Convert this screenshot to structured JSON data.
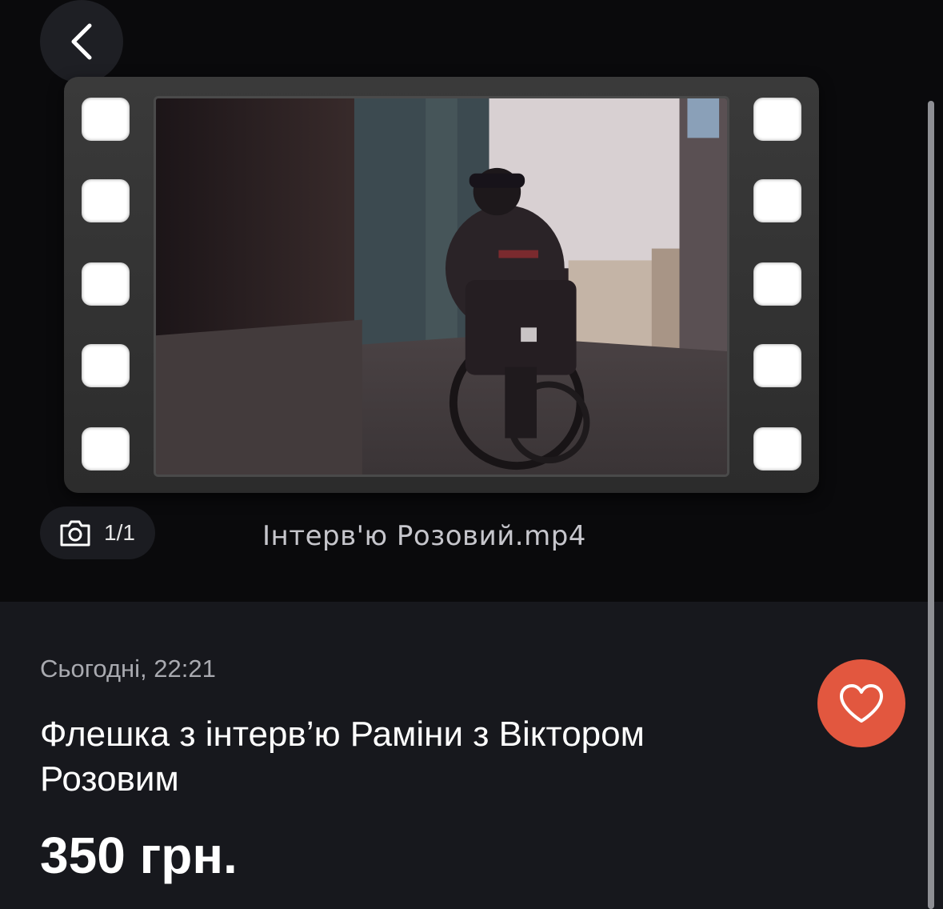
{
  "header": {
    "back_icon": "chevron-left-icon"
  },
  "gallery": {
    "file_caption": "Інтерв'ю Розовий.mp4",
    "counter": {
      "icon": "camera-icon",
      "text": "1/1"
    }
  },
  "listing": {
    "date": "Сьогодні, 22:21",
    "title": "Флешка з інтерв’ю Раміни з Віктором Розовим",
    "price": "350 грн.",
    "favorite_icon": "heart-icon",
    "favorite_color": "#e2573f"
  }
}
